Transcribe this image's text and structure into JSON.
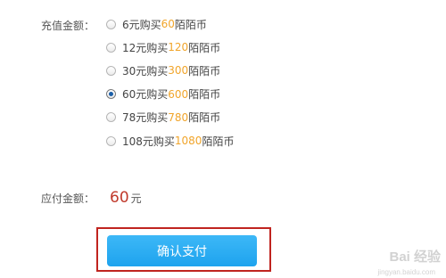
{
  "recharge": {
    "label": "充值金额：",
    "options": [
      {
        "prefix": "6元购买",
        "coins": "60",
        "suffix": "陌陌币",
        "selected": false
      },
      {
        "prefix": "12元购买",
        "coins": "120",
        "suffix": "陌陌币",
        "selected": false
      },
      {
        "prefix": "30元购买",
        "coins": "300",
        "suffix": "陌陌币",
        "selected": false
      },
      {
        "prefix": "60元购买",
        "coins": "600",
        "suffix": "陌陌币",
        "selected": true
      },
      {
        "prefix": "78元购买",
        "coins": "780",
        "suffix": "陌陌币",
        "selected": false
      },
      {
        "prefix": "108元购买",
        "coins": "1080",
        "suffix": "陌陌币",
        "selected": false
      }
    ]
  },
  "payment": {
    "label": "应付金额：",
    "amount": "60",
    "unit": "元",
    "confirm_label": "确认支付"
  },
  "watermark": {
    "text": "Bai 经验",
    "url": "jingyan.baidu.com"
  },
  "colors": {
    "coins": "#f1a52b",
    "amount": "#c0392b",
    "button": "#1ea3ee",
    "highlight_frame": "#c0241f"
  }
}
